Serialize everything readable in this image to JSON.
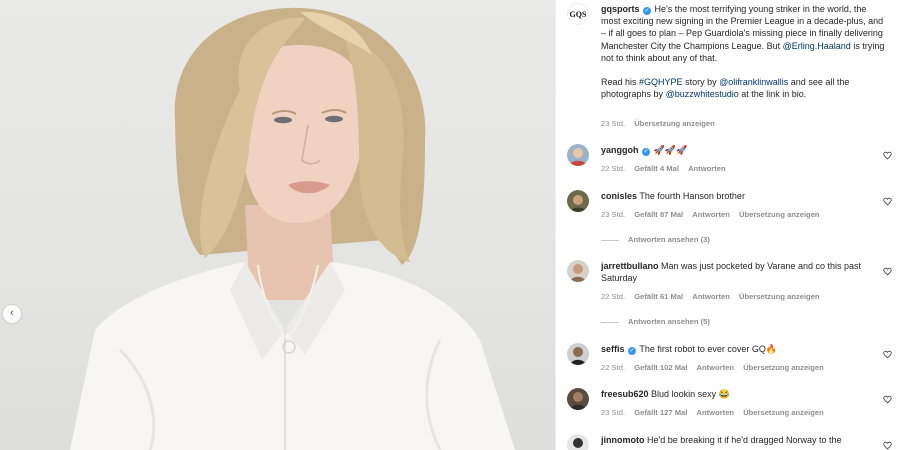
{
  "post": {
    "author": "gqsports",
    "author_logo_text": "GQS",
    "caption": "He's the most terrifying young striker in the world, the most exciting new signing in the Premier League in a decade-plus, and – if all goes to plan – Pep Guardiola's missing piece in finally delivering Manchester City the Champions League. But",
    "caption_mention": "@Erling.Haaland",
    "caption_end": "is trying not to think about any of that.",
    "read_prefix": "Read his",
    "hashtag": "#GQHYPE",
    "story_by": "story by",
    "mention_writer": "@olifranklinwallis",
    "and_see": "and see all the photographs by",
    "mention_studio": "@buzzwhitestudio",
    "link_in_bio": "at the link in bio.",
    "time": "23 Std.",
    "translate": "Übersetzung anzeigen"
  },
  "comments": [
    {
      "user": "yanggoh",
      "verified": true,
      "text": "🚀🚀🚀",
      "time": "22 Std.",
      "likes": "Gefällt 4 Mal",
      "reply": "Antworten",
      "translate": ""
    },
    {
      "user": "conisles",
      "verified": false,
      "text": "The fourth Hanson brother",
      "time": "23 Std.",
      "likes": "Gefällt 87 Mal",
      "reply": "Antworten",
      "translate": "Übersetzung anzeigen",
      "view_replies": "Antworten ansehen (3)"
    },
    {
      "user": "jarrettbullano",
      "verified": false,
      "text": "Man was just pocketed by Varane and co this past Saturday",
      "time": "22 Std.",
      "likes": "Gefällt 61 Mal",
      "reply": "Antworten",
      "translate": "Übersetzung anzeigen",
      "view_replies": "Antworten ansehen (5)"
    },
    {
      "user": "seffis",
      "verified": true,
      "text": "The first robot to ever cover GQ🔥",
      "time": "22 Std.",
      "likes": "Gefällt 102 Mal",
      "reply": "Antworten",
      "translate": "Übersetzung anzeigen"
    },
    {
      "user": "freesub620",
      "verified": false,
      "text": "Blud lookin sexy 😂",
      "time": "23 Std.",
      "likes": "Gefällt 127 Mal",
      "reply": "Antworten",
      "translate": "Übersetzung anzeigen"
    },
    {
      "user": "jinnomoto",
      "verified": false,
      "text": "He'd be breaking it if he'd dragged Norway to the",
      "time": "",
      "likes": "",
      "reply": "",
      "translate": ""
    }
  ],
  "icons": {
    "prev": "chevron-left-icon",
    "like": "heart-outline-icon",
    "verified": "verified-badge-icon"
  },
  "colors": {
    "verified": "#3897f0",
    "link": "#00376b",
    "meta": "#8e8e8e"
  }
}
